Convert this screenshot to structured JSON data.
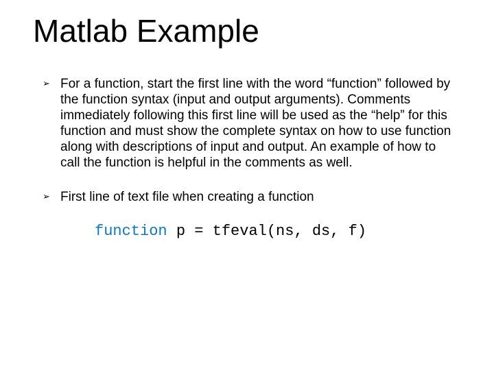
{
  "title": "Matlab Example",
  "bullets": [
    "For a function, start the first line with the word “function” followed by the function syntax (input and output arguments). Comments immediately following this first line will be used as the “help” for this function and must show the complete syntax on how to use function along with descriptions of input and output.  An example of how to call the function is helpful in the comments as well.",
    "First line of text file when creating a function"
  ],
  "code": {
    "keyword": "function",
    "rest": " p = tfeval(ns, ds, f)"
  },
  "glyph": "➢"
}
